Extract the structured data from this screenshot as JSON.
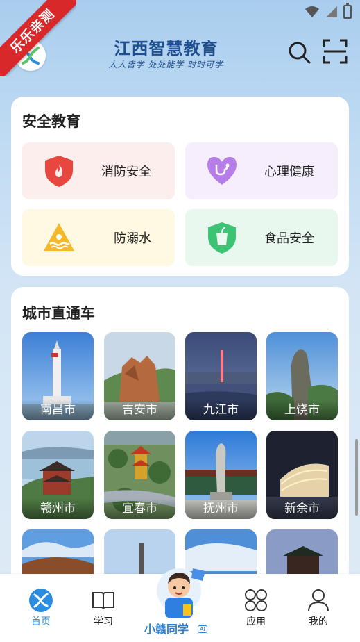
{
  "ribbon": {
    "text": "乐乐亲测"
  },
  "header": {
    "title": "江西智慧教育",
    "slogan": "人人皆学 处处能学 时时可学",
    "search_icon": "search-icon",
    "scan_icon": "scan-icon"
  },
  "safety": {
    "title": "安全教育",
    "items": [
      {
        "label": "消防安全",
        "icon": "fire-shield-icon",
        "color": "#e8473f"
      },
      {
        "label": "心理健康",
        "icon": "heart-stethoscope-icon",
        "color": "#b77de8"
      },
      {
        "label": "防溺水",
        "icon": "drowning-warning-icon",
        "color": "#f3b92a"
      },
      {
        "label": "食品安全",
        "icon": "food-shield-icon",
        "color": "#3cc474"
      }
    ]
  },
  "city": {
    "title": "城市直通车",
    "items": [
      {
        "label": "南昌市"
      },
      {
        "label": "吉安市"
      },
      {
        "label": "九江市"
      },
      {
        "label": "上饶市"
      },
      {
        "label": "赣州市"
      },
      {
        "label": "宜春市"
      },
      {
        "label": "抚州市"
      },
      {
        "label": "新余市"
      },
      {
        "label": ""
      },
      {
        "label": ""
      },
      {
        "label": ""
      },
      {
        "label": ""
      }
    ]
  },
  "nav": {
    "home": "首页",
    "study": "学习",
    "assistant": "小赣同学",
    "assistant_badge": "AI",
    "apps": "应用",
    "mine": "我的",
    "active_color": "#2a8de0"
  }
}
